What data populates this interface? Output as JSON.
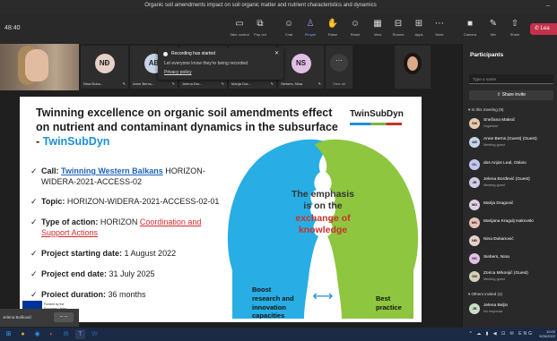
{
  "window": {
    "title": "Organic soil amendments impact on soil organic matter and nutrient characteristics and dynamics",
    "minimize": "–"
  },
  "meeting": {
    "timer": "48:40",
    "toolbar": [
      {
        "label": "Take control",
        "icon": "▭"
      },
      {
        "label": "Pop out",
        "icon": "⧉"
      },
      {
        "label": "Chat",
        "icon": "☺"
      },
      {
        "label": "People",
        "icon": "♙"
      },
      {
        "label": "Raise",
        "icon": "✋"
      },
      {
        "label": "React",
        "icon": "☺"
      },
      {
        "label": "View",
        "icon": "▦"
      },
      {
        "label": "Rooms",
        "icon": "⊟"
      },
      {
        "label": "Apps",
        "icon": "⊞"
      },
      {
        "label": "More",
        "icon": "⋯"
      },
      {
        "label": "Camera",
        "icon": "■"
      },
      {
        "label": "Mic",
        "icon": "✎"
      },
      {
        "label": "Share",
        "icon": "⇧"
      }
    ],
    "leave_label": "Lea"
  },
  "strip": {
    "tiles": [
      {
        "initials": "NĐ",
        "name": "Nina Đuka...",
        "color": "#e6d0c8"
      },
      {
        "initials": "AB",
        "name": "Anne Berns...",
        "color": "#c8d4e8"
      },
      {
        "initials": "JĐ",
        "name": "Jelena Đor...",
        "color": "#d0cde8"
      },
      {
        "initials": "MD",
        "name": "Marija Dra...",
        "color": "#e0d0e4"
      },
      {
        "initials": "NS",
        "name": "Siebers, Nina",
        "color": "#e2c0e6"
      }
    ],
    "first_name": "",
    "view_all": "View all",
    "view_all_icon": "⋯",
    "recording": {
      "title": "Recording has started",
      "body": "Let everyone know they're being recorded.",
      "link": "Privacy policy",
      "close": "✕"
    }
  },
  "slide": {
    "heading_main": "Twinning excellence on organic soil amendments effect on nutrient and contaminant dynamics in the subsurface - ",
    "heading_brand": "TwinSubDyn",
    "logo": "TwinSubDyn",
    "bullets": {
      "call_label": "Call: ",
      "call_link": "Twinning Western Balkans",
      "call_rest": " HORIZON-",
      "call_line2": "WIDERA-2021-ACCESS-02",
      "topic_label": "Topic: ",
      "topic_value": "HORIZON-WIDERA-2021-ACCESS-02-01",
      "type_label": "Type of action: ",
      "type_prefix": "HORIZON ",
      "type_red": "Coordination and",
      "type_line2": "Support Actions",
      "start_label": "Project starting date: ",
      "start_value": "1 August 2022",
      "end_label": "Project end date: ",
      "end_value": "31 July 2025",
      "duration_label": "Project duration: ",
      "duration_value": "36 months"
    },
    "check": "✓",
    "diagram": {
      "center_l1": "The emphasis",
      "center_l2": "is on the",
      "center_l3": "exchange of",
      "center_l4": "knowledge",
      "left_l1": "Boost",
      "left_l2": "research and",
      "left_l3": "innovation",
      "left_l4": "capacities",
      "right_l1": "Best",
      "right_l2": "practice",
      "arrow": "⟷",
      "left_color": "#28aee4",
      "right_color": "#8ec63f"
    },
    "page_number": "2",
    "eu_text_l1": "Funded by the",
    "eu_text_l2": "European Union"
  },
  "self_view": {
    "name": "Jelena Bošković",
    "minimize": "– –"
  },
  "panel": {
    "title": "Participants",
    "search_placeholder": "Type a name",
    "share_label": "Share invite",
    "share_icon": "⇪",
    "in_meeting": "▾ In this meeting (9)",
    "others": "▾ Others invited (1)",
    "people": [
      {
        "initials": "SM",
        "name": "Snežana Maksić",
        "role": "Organizer",
        "color": "#e8c9b0"
      },
      {
        "initials": "AB",
        "name": "Anne Berns (Guest) (Guest)",
        "role": "Meeting guest",
        "color": "#c8d4e8"
      },
      {
        "initials": "OL",
        "name": "dos Anjos Leal, Otávio",
        "role": "",
        "color": "#c4c8f0"
      },
      {
        "initials": "JĐ",
        "name": "Jelena Đorđević (Guest)",
        "role": "Meeting guest",
        "color": "#d0cde8"
      },
      {
        "initials": "MD",
        "name": "Marija Dragović",
        "role": "",
        "color": "#e0d0e4"
      },
      {
        "initials": "MK",
        "name": "Marijana Kragulj Isakovski",
        "role": "",
        "color": "#e8c0b4"
      },
      {
        "initials": "NĐ",
        "name": "Nina Đukanović",
        "role": "",
        "color": "#e6d0c8"
      },
      {
        "initials": "NS",
        "name": "Siebers, Nina",
        "role": "",
        "color": "#e2c0e6"
      },
      {
        "initials": "ZM",
        "name": "Zorica Mrkonjić (Guest)",
        "role": "Meeting guest",
        "color": "#d6d0b4"
      }
    ],
    "invited": [
      {
        "initials": "JB",
        "name": "Jelena Beljin",
        "role": "No response",
        "color": "#c8e0c8"
      }
    ]
  },
  "taskbar": {
    "icons": [
      {
        "icon": "⊞",
        "color": "#3aa0ff"
      },
      {
        "icon": "●",
        "color": "#f2a22a"
      },
      {
        "icon": "◉",
        "color": "#3b8be0"
      },
      {
        "icon": "◐",
        "color": "#e24b3b"
      },
      {
        "icon": "✉",
        "color": "#2c79d6"
      },
      {
        "icon": "T",
        "color": "#7b83eb"
      },
      {
        "icon": "W",
        "color": "#2b5fb4"
      }
    ],
    "tray": "^ ☁ ▮ ◀ ⊡ ✉ ENG",
    "time": "10:00",
    "date": "9/26/2022"
  }
}
